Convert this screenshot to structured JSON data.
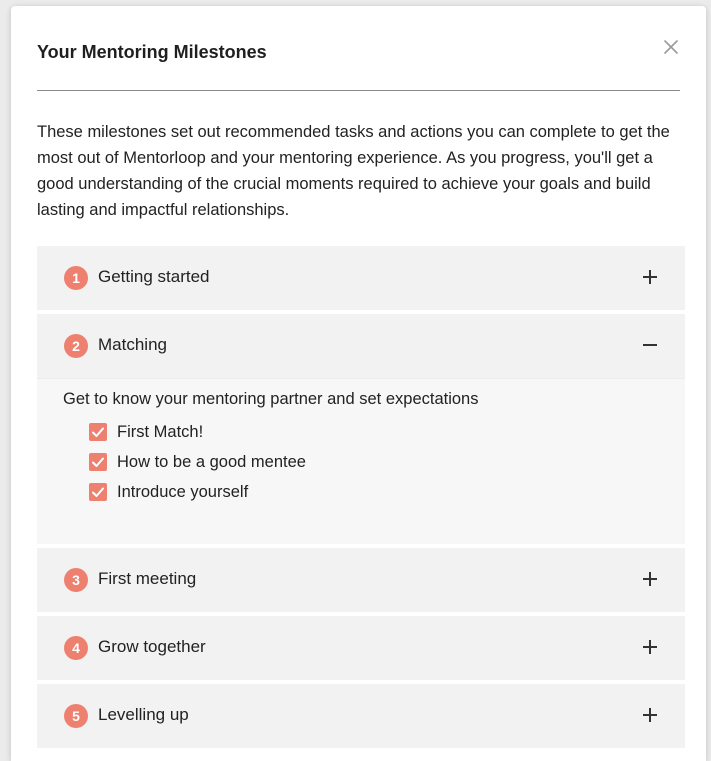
{
  "modal": {
    "title": "Your Mentoring Milestones",
    "intro": "These milestones set out recommended tasks and actions you can complete to get the most out of Mentorloop and your mentoring experience. As you progress, you'll get a good understanding of the crucial moments required to achieve your goals and build lasting and impactful relationships."
  },
  "colors": {
    "accent": "#ee8070",
    "panel": "#f2f2f2",
    "panel_open": "#f7f7f7"
  },
  "milestones": [
    {
      "number": "1",
      "label": "Getting started",
      "expanded": false,
      "toggle_icon": "plus-icon"
    },
    {
      "number": "2",
      "label": "Matching",
      "expanded": true,
      "toggle_icon": "minus-icon",
      "description": "Get to know your mentoring partner and set expectations",
      "tasks": [
        {
          "label": "First Match!",
          "checked": true
        },
        {
          "label": "How to be a good mentee",
          "checked": true
        },
        {
          "label": "Introduce yourself",
          "checked": true
        }
      ]
    },
    {
      "number": "3",
      "label": "First meeting",
      "expanded": false,
      "toggle_icon": "plus-icon"
    },
    {
      "number": "4",
      "label": "Grow together",
      "expanded": false,
      "toggle_icon": "plus-icon"
    },
    {
      "number": "5",
      "label": "Levelling up",
      "expanded": false,
      "toggle_icon": "plus-icon"
    }
  ]
}
